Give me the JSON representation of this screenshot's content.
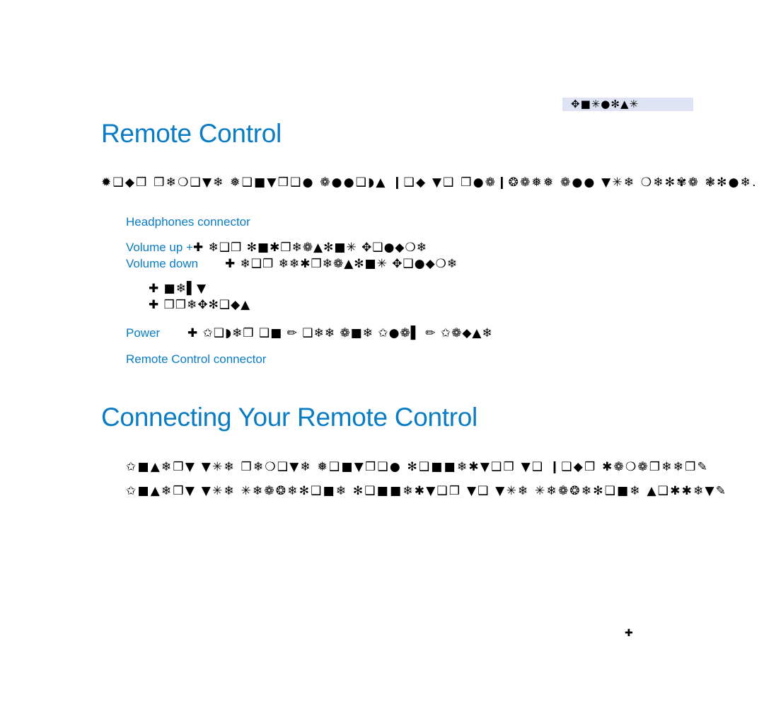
{
  "page": {
    "chapter_tab": "✥■✳●✻▲✳",
    "sections": [
      {
        "title": "Remote Control",
        "intro": "✹❑◆❒ ❒❄❍❑▼❄ ❅❑■▼❒❑● ❁●●❑◗▲ ❙❑◆ ▼❑ ❒●❁❙❂❁❅❅ ❁●● ▼✳❄ ❍❄✻✾❁ ❃✻●❄."
      }
    ],
    "labels": [
      {
        "term": "Headphones connector",
        "desc": ""
      },
      {
        "term": "Volume up +",
        "desc": "✚ ❄❑❒ ✻■✱❒❄❁▲✻■✳ ✥❑●◆❍❄"
      },
      {
        "term": "Volume down",
        "desc": "✚ ❄❑❒ ❄❄✱❒❄❁▲✻■✳ ✥❑●◆❍❄"
      },
      {
        "term": "",
        "desc": "✚ ■❄▌▼"
      },
      {
        "term": "",
        "desc": "✚ ❒❒❄✥✻❑◆▲"
      },
      {
        "term": "Power",
        "desc": "✚ ✩❑◗❄❒ ❑■ ✏ ❑❄❄ ❁■❄ ✩●❁▌ ✏ ✩❁◆▲❄"
      },
      {
        "term": "Remote Control connector",
        "desc": ""
      }
    ],
    "section2": {
      "title": "Connecting Your Remote Control",
      "steps": [
        "✩■▲❄❒▼ ▼✳❄ ❒❄❍❑▼❄ ❅❑■▼❒❑● ✻❑■■❄✱▼❑❒ ▼❑ ❙❑◆❒ ✱❁❍❁❒❄❄❒✎",
        "✩■▲❄❒▼ ▼✳❄ ✳❄❁❂❄✻❑■❄ ✻❑■■❄✱▼❑❒ ▼❑ ▼✳❄ ✳❄❁❂❄✻❑■❄ ▲❑✱✱❄▼✎"
      ]
    },
    "footer_mark": "✚"
  }
}
